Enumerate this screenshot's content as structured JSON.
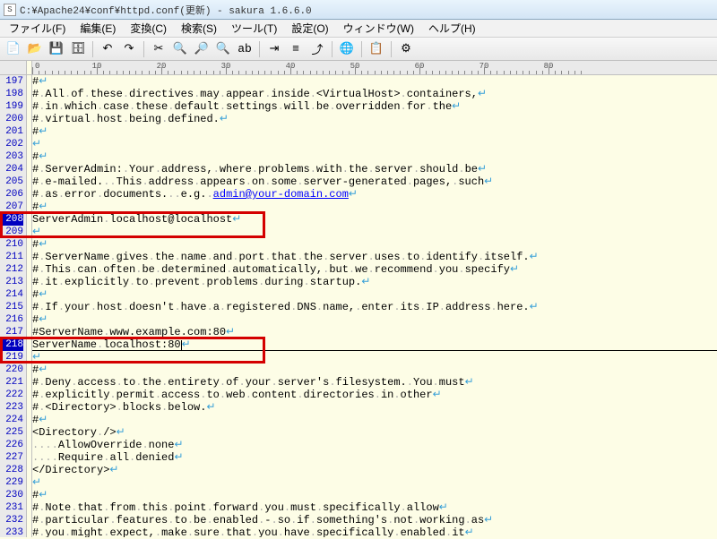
{
  "window": {
    "title": "C:¥Apache24¥conf¥httpd.conf(更新) - sakura 1.6.6.0"
  },
  "menus": [
    "ファイル(F)",
    "編集(E)",
    "変換(C)",
    "検索(S)",
    "ツール(T)",
    "設定(O)",
    "ウィンドウ(W)",
    "ヘルプ(H)"
  ],
  "toolbar_icons": [
    {
      "name": "new-file-icon",
      "glyph": "📄"
    },
    {
      "name": "open-file-icon",
      "glyph": "📂"
    },
    {
      "name": "save-icon",
      "glyph": "💾"
    },
    {
      "name": "save-all-icon",
      "glyph": "🗄"
    },
    {
      "sep": true
    },
    {
      "name": "undo-icon",
      "glyph": "↶"
    },
    {
      "name": "redo-icon",
      "glyph": "↷"
    },
    {
      "sep": true
    },
    {
      "name": "cut-icon",
      "glyph": "✂"
    },
    {
      "name": "find-icon",
      "glyph": "🔍"
    },
    {
      "name": "find-next-icon",
      "glyph": "🔎"
    },
    {
      "name": "find-prev-icon",
      "glyph": "🔍"
    },
    {
      "name": "replace-icon",
      "glyph": "ab"
    },
    {
      "sep": true
    },
    {
      "name": "jump-icon",
      "glyph": "⇥"
    },
    {
      "name": "outline-icon",
      "glyph": "≡"
    },
    {
      "name": "tag-jump-icon",
      "glyph": "⤴"
    },
    {
      "sep": true
    },
    {
      "name": "browser-icon",
      "glyph": "🌐"
    },
    {
      "sep": true
    },
    {
      "name": "type-list-icon",
      "glyph": "📋"
    },
    {
      "sep": true
    },
    {
      "name": "settings-icon",
      "glyph": "⚙"
    }
  ],
  "ruler_majors": [
    0,
    10,
    20,
    30,
    40,
    50,
    60,
    70,
    80
  ],
  "lines": [
    {
      "n": 197,
      "t": "#"
    },
    {
      "n": 198,
      "t": "# All of these directives may appear inside <VirtualHost> containers,"
    },
    {
      "n": 199,
      "t": "# in which case these default settings will be overridden for the"
    },
    {
      "n": 200,
      "t": "# virtual host being defined."
    },
    {
      "n": 201,
      "t": "#"
    },
    {
      "n": 202,
      "t": ""
    },
    {
      "n": 203,
      "t": "#"
    },
    {
      "n": 204,
      "t": "# ServerAdmin: Your address, where problems with the server should be"
    },
    {
      "n": 205,
      "t": "# e-mailed.  This address appears on some server-generated pages, such"
    },
    {
      "n": 206,
      "t": "# as error documents.  e.g. ",
      "url": "admin@your-domain.com"
    },
    {
      "n": 207,
      "t": "#"
    },
    {
      "n": 208,
      "t": "ServerAdmin localhost@localhost",
      "active": true
    },
    {
      "n": 209,
      "t": ""
    },
    {
      "n": 210,
      "t": "#"
    },
    {
      "n": 211,
      "t": "# ServerName gives the name and port that the server uses to identify itself."
    },
    {
      "n": 212,
      "t": "# This can often be determined automatically, but we recommend you specify"
    },
    {
      "n": 213,
      "t": "# it explicitly to prevent problems during startup."
    },
    {
      "n": 214,
      "t": "#"
    },
    {
      "n": 215,
      "t": "# If your host doesn't have a registered DNS name, enter its IP address here."
    },
    {
      "n": 216,
      "t": "#"
    },
    {
      "n": 217,
      "t": "#ServerName www.example.com:80"
    },
    {
      "n": 218,
      "t": "ServerName localhost:80",
      "active": true,
      "caret": true
    },
    {
      "n": 219,
      "t": ""
    },
    {
      "n": 220,
      "t": "#"
    },
    {
      "n": 221,
      "t": "# Deny access to the entirety of your server's filesystem. You must"
    },
    {
      "n": 222,
      "t": "# explicitly permit access to web content directories in other"
    },
    {
      "n": 223,
      "t": "# <Directory> blocks below."
    },
    {
      "n": 224,
      "t": "#"
    },
    {
      "n": 225,
      "t": "<Directory />"
    },
    {
      "n": 226,
      "t": "    AllowOverride none"
    },
    {
      "n": 227,
      "t": "    Require all denied"
    },
    {
      "n": 228,
      "t": "</Directory>"
    },
    {
      "n": 229,
      "t": ""
    },
    {
      "n": 230,
      "t": "#"
    },
    {
      "n": 231,
      "t": "# Note that from this point forward you must specifically allow"
    },
    {
      "n": 232,
      "t": "# particular features to be enabled - so if something's not working as"
    },
    {
      "n": 233,
      "t": "# you might expect, make sure that you have specifically enabled it"
    }
  ],
  "highlights": [
    {
      "top_line": 208,
      "height_lines": 2
    },
    {
      "top_line": 218,
      "height_lines": 2
    }
  ]
}
